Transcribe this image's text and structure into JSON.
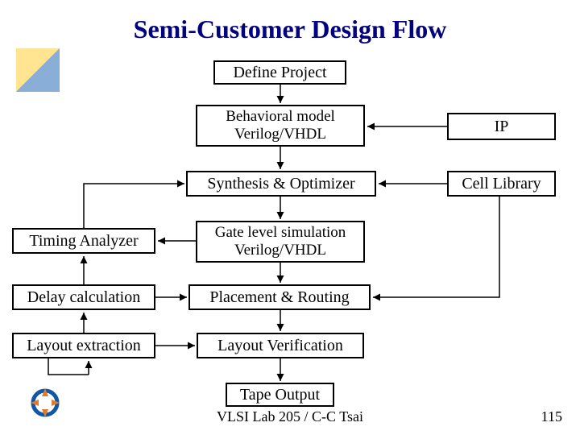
{
  "title": "Semi-Customer Design Flow",
  "boxes": {
    "define": "Define Project",
    "behavioral_l1": "Behavioral model",
    "behavioral_l2": "Verilog/VHDL",
    "ip": "IP",
    "synth": "Synthesis & Optimizer",
    "cell": "Cell Library",
    "timing": "Timing Analyzer",
    "gate_l1": "Gate level simulation",
    "gate_l2": "Verilog/VHDL",
    "delay": "Delay calculation",
    "place": "Placement & Routing",
    "layoutext": "Layout extraction",
    "layoutver": "Layout Verification",
    "tape": "Tape Output"
  },
  "footer": "VLSI Lab 205 / C-C Tsai",
  "page": "115"
}
